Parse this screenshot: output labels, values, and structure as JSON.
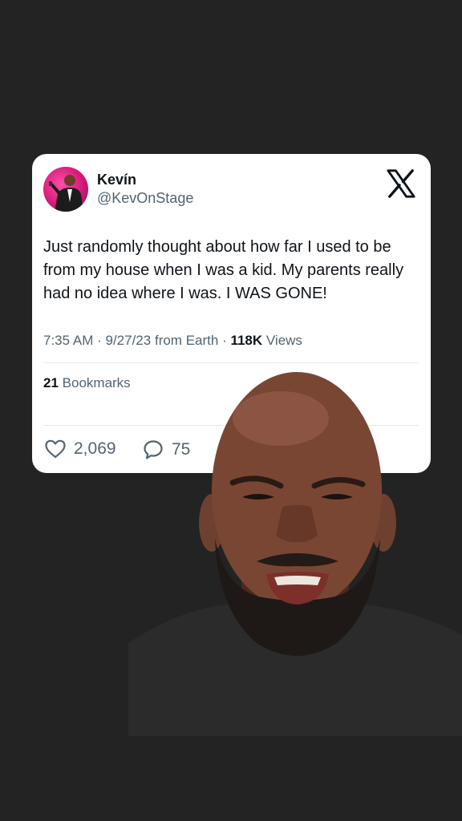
{
  "tweet": {
    "display_name": "Kevín",
    "handle": "@KevOnStage",
    "text": "Just randomly thought about how far I used to be from my house when I was a kid. My parents really had no idea where I was.  I WAS GONE!",
    "time": "7:35 AM",
    "date": "9/27/23",
    "source": "from Earth",
    "views_count": "118K",
    "views_label": "Views",
    "bookmarks_count": "21",
    "bookmarks_label": "Bookmarks",
    "likes": "2,069",
    "replies": "75"
  },
  "icons": {
    "logo": "x-logo-icon",
    "like": "heart-icon",
    "reply": "speech-bubble-icon"
  },
  "colors": {
    "background": "#232323",
    "card": "#ffffff",
    "text_primary": "#0f1419",
    "text_secondary": "#536471",
    "avatar_accent": "#d51a78"
  }
}
